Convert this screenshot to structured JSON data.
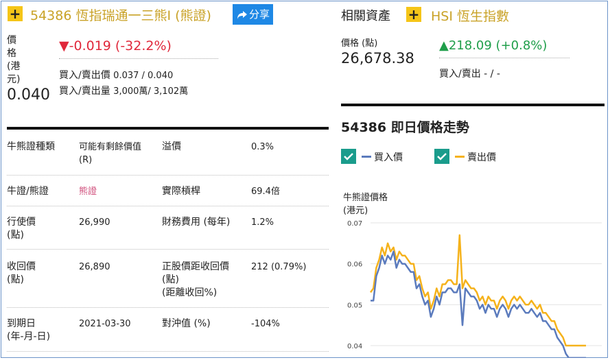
{
  "left": {
    "plus_symbol": "+",
    "title": "54386 恆指瑞通一三熊I (熊證)",
    "share_label": "分享",
    "price_label_chars": [
      "價",
      "格",
      "(港",
      "元)"
    ],
    "price": "0.040",
    "change_arrow": "▼",
    "change": "-0.019 (-32.2%)",
    "bid_ask_label": "買入/賣出價",
    "bid_ask_value": "0.037 / 0.040",
    "bid_ask_vol_label": "買入/賣出量",
    "bid_ask_vol_value": "3,000萬/ 3,102萬"
  },
  "details": [
    {
      "k1": "牛熊證種類",
      "v1": "可能有剩餘價值\n(R)",
      "k2": "溢價",
      "v2": "0.3%"
    },
    {
      "k1": "牛證/熊證",
      "v1": "熊證",
      "k2": "實際槓桿",
      "v2": "69.4倍"
    },
    {
      "k1": "行使價\n(點)",
      "v1": "26,990",
      "k2": "財務費用 (每年)",
      "v2": "1.2%"
    },
    {
      "k1": "收回價\n(點)",
      "v1": "26,890",
      "k2": "正股價距收回價\n(點)\n(距離收回%)",
      "v2": "212 (0.79%)"
    },
    {
      "k1": "到期日\n(年-月-日)",
      "v1": "2021-03-30",
      "k2": "對沖值 (%)",
      "v2": "-104%"
    }
  ],
  "right": {
    "related_label": "相關資產",
    "plus_symbol": "+",
    "asset_name": "HSI 恆生指數",
    "price_label": "價格 (點)",
    "price": "26,678.38",
    "change_arrow": "▲",
    "change": "218.09 (+0.8%)",
    "bid_ask_label": "買入/賣出 - / -",
    "chart_title": "54386 即日價格走勢",
    "legend_bid": "買入價",
    "legend_ask": "賣出價",
    "ylabel_line1": "牛熊證價格",
    "ylabel_line2": "(港元)"
  },
  "colors": {
    "gold": "#c9a227",
    "down": "#e0283b",
    "up": "#1f9e4a",
    "bid_line": "#5b7bbd",
    "ask_line": "#f5b21b"
  },
  "chart_data": {
    "type": "line",
    "title": "54386 即日價格走勢",
    "ylabel": "牛熊證價格 (港元)",
    "ylim": [
      0.0375,
      0.07
    ],
    "yticks": [
      0.04,
      0.05,
      0.06,
      0.07
    ],
    "series": [
      {
        "name": "買入價",
        "values": [
          0.051,
          0.051,
          0.057,
          0.059,
          0.062,
          0.06,
          0.062,
          0.061,
          0.063,
          0.059,
          0.061,
          0.06,
          0.06,
          0.059,
          0.058,
          0.058,
          0.054,
          0.055,
          0.052,
          0.05,
          0.051,
          0.047,
          0.049,
          0.052,
          0.05,
          0.053,
          0.053,
          0.054,
          0.054,
          0.053,
          0.053,
          0.055,
          0.045,
          0.054,
          0.053,
          0.052,
          0.052,
          0.051,
          0.049,
          0.05,
          0.048,
          0.05,
          0.049,
          0.049,
          0.047,
          0.049,
          0.05,
          0.049,
          0.047,
          0.049,
          0.05,
          0.049,
          0.05,
          0.049,
          0.048,
          0.048,
          0.049,
          0.048,
          0.047,
          0.048,
          0.046,
          0.046,
          0.045,
          0.044,
          0.044,
          0.042,
          0.041,
          0.04,
          0.038,
          0.037,
          0.037,
          0.037,
          0.037,
          0.037,
          0.037,
          0.037
        ]
      },
      {
        "name": "賣出價",
        "values": [
          0.053,
          0.054,
          0.059,
          0.061,
          0.064,
          0.062,
          0.065,
          0.063,
          0.064,
          0.061,
          0.063,
          0.062,
          0.062,
          0.061,
          0.06,
          0.06,
          0.056,
          0.057,
          0.054,
          0.052,
          0.053,
          0.049,
          0.051,
          0.054,
          0.052,
          0.055,
          0.055,
          0.056,
          0.056,
          0.055,
          0.055,
          0.067,
          0.054,
          0.056,
          0.055,
          0.054,
          0.054,
          0.053,
          0.051,
          0.052,
          0.05,
          0.052,
          0.051,
          0.051,
          0.049,
          0.051,
          0.052,
          0.051,
          0.049,
          0.051,
          0.052,
          0.051,
          0.052,
          0.051,
          0.05,
          0.05,
          0.051,
          0.05,
          0.049,
          0.05,
          0.048,
          0.048,
          0.047,
          0.046,
          0.046,
          0.044,
          0.043,
          0.042,
          0.04,
          0.04,
          0.04,
          0.04,
          0.04,
          0.04,
          0.04,
          0.04
        ]
      }
    ]
  }
}
